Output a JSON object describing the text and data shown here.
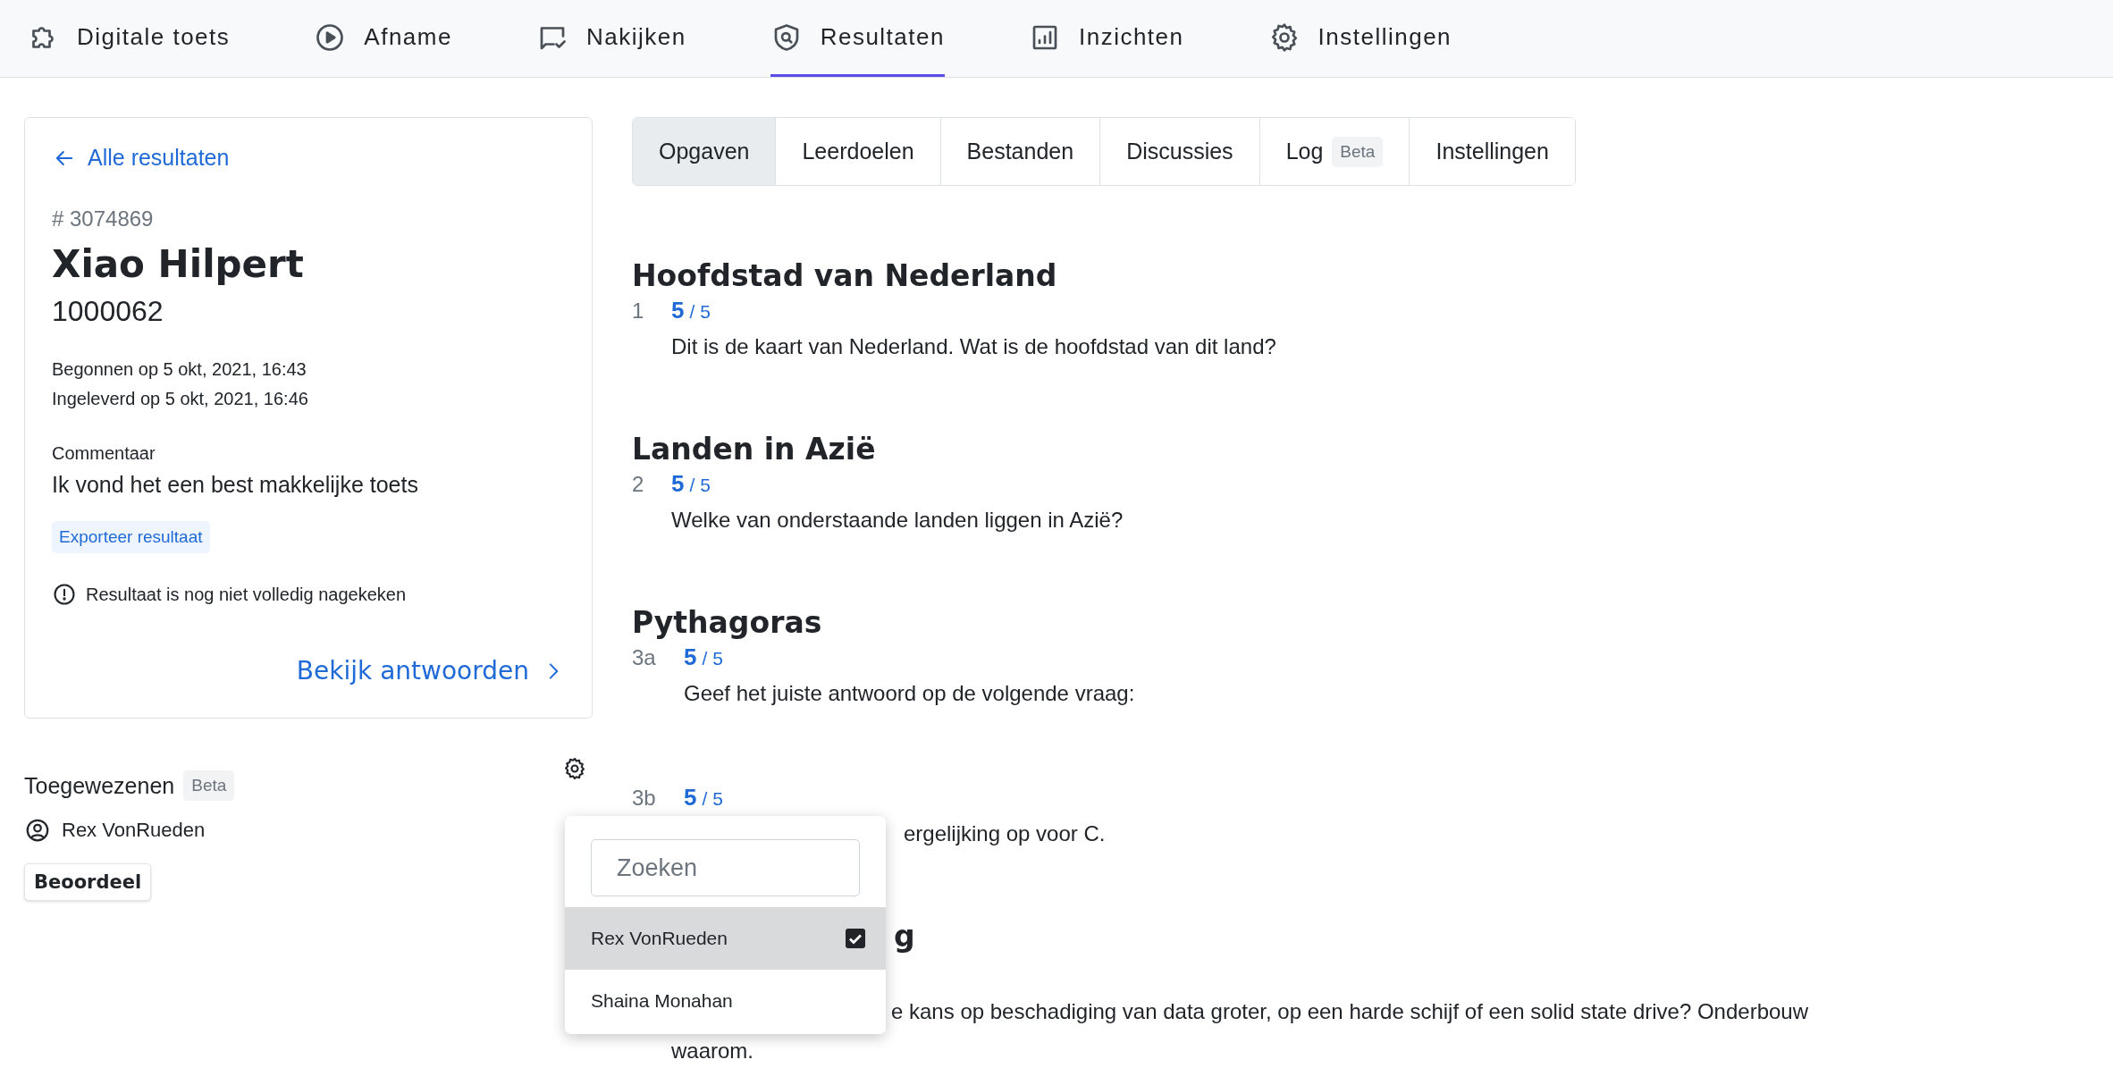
{
  "nav": [
    {
      "label": "Digitale toets",
      "selected": false
    },
    {
      "label": "Afname",
      "selected": false
    },
    {
      "label": "Nakijken",
      "selected": false
    },
    {
      "label": "Resultaten",
      "selected": true
    },
    {
      "label": "Inzichten",
      "selected": false
    },
    {
      "label": "Instellingen",
      "selected": false
    }
  ],
  "result_card": {
    "back_link": "Alle resultaten",
    "id": "# 3074869",
    "name": "Xiao Hilpert",
    "student_number": "1000062",
    "started": "Begonnen op 5 okt, 2021, 16:43",
    "submitted": "Ingeleverd op 5 okt, 2021, 16:46",
    "comment_label": "Commentaar",
    "comment": "Ik vond het een best makkelijke toets",
    "export_button": "Exporteer resultaat",
    "warning": "Resultaat is nog niet volledig nagekeken",
    "answers_link": "Bekijk antwoorden"
  },
  "assignees": {
    "title": "Toegewezenen",
    "badge": "Beta",
    "people": [
      {
        "name": "Rex VonRueden"
      }
    ],
    "button": "Beoordeel"
  },
  "assign_menu": {
    "search": {
      "placeholder": "Zoeken"
    },
    "options": [
      {
        "name": "Rex VonRueden",
        "selected": true,
        "checked": true
      },
      {
        "name": "Shaina Monahan",
        "selected": false,
        "checked": false
      }
    ]
  },
  "tabs": [
    {
      "label": "Opgaven",
      "selected": true
    },
    {
      "label": "Leerdoelen",
      "selected": false
    },
    {
      "label": "Bestanden",
      "selected": false
    },
    {
      "label": "Discussies",
      "selected": false
    },
    {
      "label": "Log",
      "badge": "Beta",
      "selected": false
    },
    {
      "label": "Instellingen",
      "selected": false
    }
  ],
  "sections": [
    {
      "title": "Hoofdstad van Nederland",
      "questions": [
        {
          "number": "1",
          "score": "5",
          "max": "/ 5",
          "text": "Dit is de kaart van Nederland. Wat is de hoofdstad van dit land?"
        }
      ]
    },
    {
      "title": "Landen in Azië",
      "questions": [
        {
          "number": "2",
          "score": "5",
          "max": "/ 5",
          "text": "Welke van onderstaande landen liggen in Azië?"
        }
      ]
    },
    {
      "title": "Pythagoras",
      "questions": [
        {
          "number": "3a",
          "score": "5",
          "max": "/ 5",
          "text": "Geef het juiste antwoord op de volgende vraag:"
        },
        {
          "number": "3b",
          "score": "5",
          "max": "/ 5",
          "text": "ergelijking op voor C.",
          "covered": true
        }
      ]
    },
    {
      "title": "g",
      "covered": true,
      "questions": [
        {
          "text": "e kans op beschadiging van data groter, op een harde schijf of een solid state drive? Onderbouw",
          "continued": "waarom.",
          "covered": true
        }
      ]
    }
  ]
}
